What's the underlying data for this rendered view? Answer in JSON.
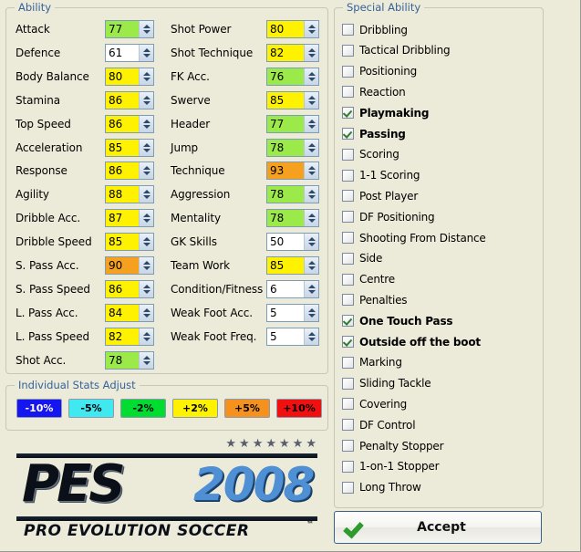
{
  "ability": {
    "legend": "Ability",
    "column1": [
      {
        "label": "Attack",
        "value": "77",
        "color": "#9BEA4A"
      },
      {
        "label": "Defence",
        "value": "61",
        "color": "#FFFFFF"
      },
      {
        "label": "Body Balance",
        "value": "80",
        "color": "#FFF200"
      },
      {
        "label": "Stamina",
        "value": "86",
        "color": "#FFF200"
      },
      {
        "label": "Top Speed",
        "value": "86",
        "color": "#FFF200"
      },
      {
        "label": "Acceleration",
        "value": "85",
        "color": "#FFF200"
      },
      {
        "label": "Response",
        "value": "86",
        "color": "#FFF200"
      },
      {
        "label": "Agility",
        "value": "88",
        "color": "#FFF200"
      },
      {
        "label": "Dribble Acc.",
        "value": "87",
        "color": "#FFF200"
      },
      {
        "label": "Dribble Speed",
        "value": "85",
        "color": "#FFF200"
      },
      {
        "label": "S. Pass Acc.",
        "value": "90",
        "color": "#F5A01E"
      },
      {
        "label": "S. Pass Speed",
        "value": "86",
        "color": "#FFF200"
      },
      {
        "label": "L. Pass Acc.",
        "value": "84",
        "color": "#FFF200"
      },
      {
        "label": "L. Pass Speed",
        "value": "82",
        "color": "#FFF200"
      },
      {
        "label": "Shot Acc.",
        "value": "78",
        "color": "#9BEA4A"
      }
    ],
    "column2": [
      {
        "label": "Shot Power",
        "value": "80",
        "color": "#FFF200"
      },
      {
        "label": "Shot Technique",
        "value": "82",
        "color": "#FFF200"
      },
      {
        "label": "FK Acc.",
        "value": "76",
        "color": "#9BEA4A"
      },
      {
        "label": "Swerve",
        "value": "85",
        "color": "#FFF200"
      },
      {
        "label": "Header",
        "value": "77",
        "color": "#9BEA4A"
      },
      {
        "label": "Jump",
        "value": "78",
        "color": "#9BEA4A"
      },
      {
        "label": "Technique",
        "value": "93",
        "color": "#F5A01E"
      },
      {
        "label": "Aggression",
        "value": "78",
        "color": "#9BEA4A"
      },
      {
        "label": "Mentality",
        "value": "78",
        "color": "#9BEA4A"
      },
      {
        "label": "GK Skills",
        "value": "50",
        "color": "#FFFFFF"
      },
      {
        "label": "Team Work",
        "value": "85",
        "color": "#FFF200"
      },
      {
        "label": "Condition/Fitness",
        "value": "6",
        "color": "#FFFFFF"
      },
      {
        "label": "Weak Foot Acc.",
        "value": "5",
        "color": "#FFFFFF"
      },
      {
        "label": "Weak Foot Freq.",
        "value": "5",
        "color": "#FFFFFF"
      }
    ]
  },
  "special_ability": {
    "legend": "Special Ability",
    "items": [
      {
        "label": "Dribbling",
        "checked": false
      },
      {
        "label": "Tactical Dribbling",
        "checked": false
      },
      {
        "label": "Positioning",
        "checked": false
      },
      {
        "label": "Reaction",
        "checked": false
      },
      {
        "label": "Playmaking",
        "checked": true
      },
      {
        "label": "Passing",
        "checked": true
      },
      {
        "label": "Scoring",
        "checked": false
      },
      {
        "label": "1-1 Scoring",
        "checked": false
      },
      {
        "label": "Post Player",
        "checked": false
      },
      {
        "label": "DF Positioning",
        "checked": false
      },
      {
        "label": "Shooting From Distance",
        "checked": false
      },
      {
        "label": "Side",
        "checked": false
      },
      {
        "label": "Centre",
        "checked": false
      },
      {
        "label": "Penalties",
        "checked": false
      },
      {
        "label": "One Touch Pass",
        "checked": true
      },
      {
        "label": "Outside off the boot",
        "checked": true
      },
      {
        "label": "Marking",
        "checked": false
      },
      {
        "label": "Sliding Tackle",
        "checked": false
      },
      {
        "label": "Covering",
        "checked": false
      },
      {
        "label": "DF Control",
        "checked": false
      },
      {
        "label": "Penalty Stopper",
        "checked": false
      },
      {
        "label": "1-on-1 Stopper",
        "checked": false
      },
      {
        "label": "Long Throw",
        "checked": false
      }
    ]
  },
  "adjust": {
    "legend": "Individual Stats Adjust",
    "buttons": [
      {
        "label": "-10%",
        "bg": "#1515F0",
        "fg": "#FFFFFF"
      },
      {
        "label": "-5%",
        "bg": "#40E8F0",
        "fg": "#000000"
      },
      {
        "label": "-2%",
        "bg": "#00DD30",
        "fg": "#000000"
      },
      {
        "label": "+2%",
        "bg": "#FFF200",
        "fg": "#000000"
      },
      {
        "label": "+5%",
        "bg": "#F5921E",
        "fg": "#000000"
      },
      {
        "label": "+10%",
        "bg": "#F01010",
        "fg": "#000000"
      }
    ]
  },
  "logo": {
    "stars": "★★★★★★★",
    "word": "PES",
    "year": "2008",
    "subtitle": "PRO EVOLUTION SOCCER",
    "tm": "™"
  },
  "accept": {
    "label": "Accept"
  }
}
